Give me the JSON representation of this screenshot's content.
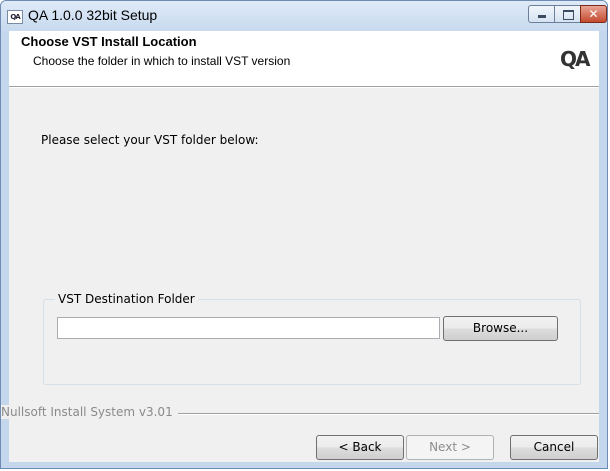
{
  "window": {
    "title": "QA 1.0.0 32bit Setup",
    "icon": "qa-app-icon",
    "icon_text": "QA",
    "controls": [
      "minimize",
      "maximize",
      "close"
    ]
  },
  "header": {
    "title": "Choose VST Install Location",
    "subtitle": "Choose the folder in which to install VST version",
    "logo_text": "QA"
  },
  "body": {
    "prompt": "Please select your VST folder below:",
    "group_label": "VST Destination Folder",
    "folder_value": "",
    "browse_label": "Browse..."
  },
  "footer": {
    "branding": "Nullsoft Install System v3.01",
    "back_label": "< Back",
    "next_label": "Next >",
    "cancel_label": "Cancel"
  },
  "colors": {
    "title_bar": "#c8daef",
    "close_button": "#c44b2f",
    "dialog_bg": "#f0f0f0"
  }
}
